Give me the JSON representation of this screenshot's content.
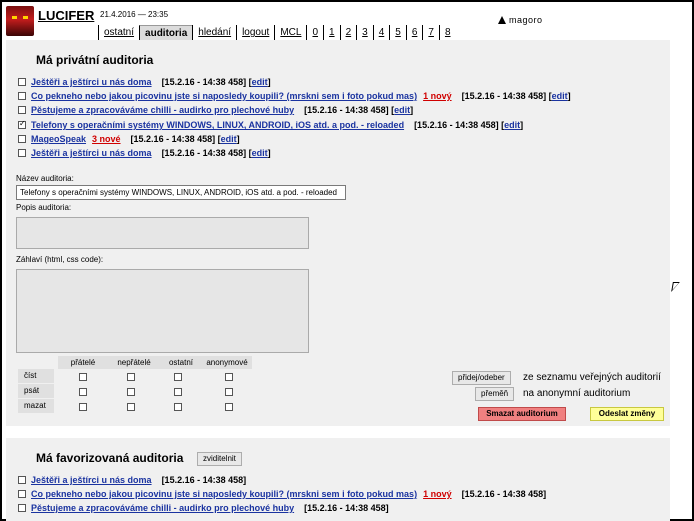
{
  "header": {
    "brand": "LUCIFER",
    "datetime": "21.4.2016 — 23:35",
    "partner": "magoro",
    "nav": [
      "ostatní",
      "auditoria",
      "hledání",
      "logout",
      "MCL",
      "0",
      "1",
      "2",
      "3",
      "4",
      "5",
      "6",
      "7",
      "8"
    ],
    "active_tab": "auditoria"
  },
  "private": {
    "title": "Má privátní auditoria",
    "items": [
      {
        "name": "Ještěři a ještírci u nás doma",
        "new": "",
        "meta": "[15.2.16 - 14:38 458] [",
        "edit": "edit",
        "close": "]",
        "checked": false
      },
      {
        "name": "Co pekneho nebo jakou picovinu jste si naposledy koupili? (mrskni sem i foto pokud mas)",
        "new": "1 nový",
        "meta": "[15.2.16 - 14:38 458] [",
        "edit": "edit",
        "close": "]",
        "checked": false
      },
      {
        "name": "Pěstujeme a zpracováváme chilli - audirko pro plechové huby",
        "new": "",
        "meta": "[15.2.16 - 14:38 458] [",
        "edit": "edit",
        "close": "]",
        "checked": false
      },
      {
        "name": "Telefony s operačními systémy WINDOWS, LINUX, ANDROID, iOS atd. a pod. - reloaded",
        "new": "",
        "meta": "[15.2.16 - 14:38 458] [",
        "edit": "edit",
        "close": "]",
        "checked": true
      },
      {
        "name": "MageoSpeak",
        "new": "3 nové",
        "meta": "[15.2.16 - 14:38 458] [",
        "edit": "edit",
        "close": "]",
        "checked": false
      },
      {
        "name": "Ještěři a ještírci u nás doma",
        "new": "",
        "meta": "[15.2.16 - 14:38 458] [",
        "edit": "edit",
        "close": "]",
        "checked": false
      }
    ]
  },
  "form": {
    "name_label": "Název auditoria:",
    "name_value": "Telefony s operačními systémy WINDOWS, LINUX, ANDROID, iOS atd. a pod. - reloaded",
    "desc_label": "Popis auditoria:",
    "desc_value": "",
    "header_label": "Záhlaví (html, css code):",
    "header_value": ""
  },
  "permissions": {
    "columns": [
      "přátelé",
      "nepřátelé",
      "ostatní",
      "anonymové"
    ],
    "rows": [
      "číst",
      "psát",
      "mazat"
    ]
  },
  "actions": {
    "toggle_public_label": "přidej/odeber",
    "toggle_public_text": "ze seznamu veřejných auditorií",
    "anon_label": "přeměň",
    "anon_text": "na anonymní auditorium",
    "delete_label": "Smazat auditorium",
    "save_label": "Odeslat změny"
  },
  "favorites": {
    "title": "Má favorizovaná auditoria",
    "show_button": "zviditelnit",
    "items": [
      {
        "name": "Ještěři a ještírci u nás doma",
        "new": "",
        "meta": "[15.2.16 - 14:38 458]"
      },
      {
        "name": "Co pekneho nebo jakou picovinu jste si naposledy koupili? (mrskni sem i foto pokud mas)",
        "new": "1 nový",
        "meta": "[15.2.16 - 14:38 458]"
      },
      {
        "name": "Pěstujeme a zpracováváme chilli - audirko pro plechové huby",
        "new": "",
        "meta": "[15.2.16 - 14:38 458]"
      }
    ]
  },
  "colors": {
    "link": "#1a33a0",
    "new_badge": "#d00000",
    "panel_bg": "#f0f0f0",
    "delete_bg": "#f08080",
    "save_bg": "#ffff99"
  }
}
